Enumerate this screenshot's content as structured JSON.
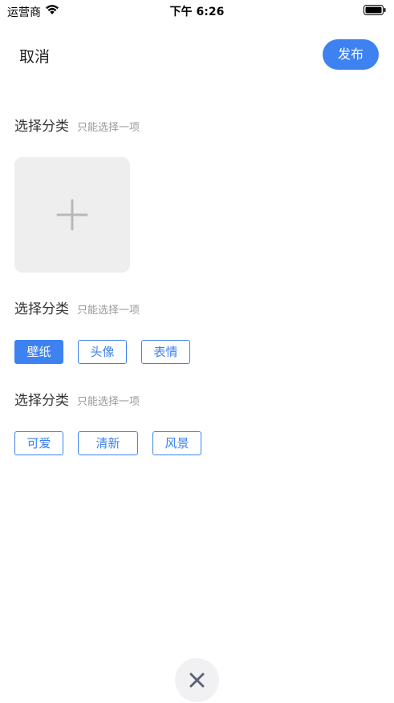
{
  "status_bar": {
    "carrier": "运营商",
    "time": "下午 6:26",
    "wifi_icon": "wifi-icon",
    "battery_icon": "battery-icon"
  },
  "nav": {
    "cancel_label": "取消",
    "publish_label": "发布"
  },
  "sections": [
    {
      "title": "选择分类",
      "hint": "只能选择一项"
    },
    {
      "title": "选择分类",
      "hint": "只能选择一项"
    },
    {
      "title": "选择分类",
      "hint": "只能选择一项"
    }
  ],
  "add_image_icon": "plus-icon",
  "tag_groups": [
    {
      "tags": [
        "壁纸",
        "头像",
        "表情"
      ],
      "selected": "壁纸"
    },
    {
      "tags": [
        "可爱",
        "清新",
        "风景"
      ],
      "selected": ""
    }
  ],
  "close_icon": "close-icon",
  "colors": {
    "accent": "#3d82f0",
    "placeholder_bg": "#eeeeee",
    "fab_bg": "#f1f1f4"
  }
}
